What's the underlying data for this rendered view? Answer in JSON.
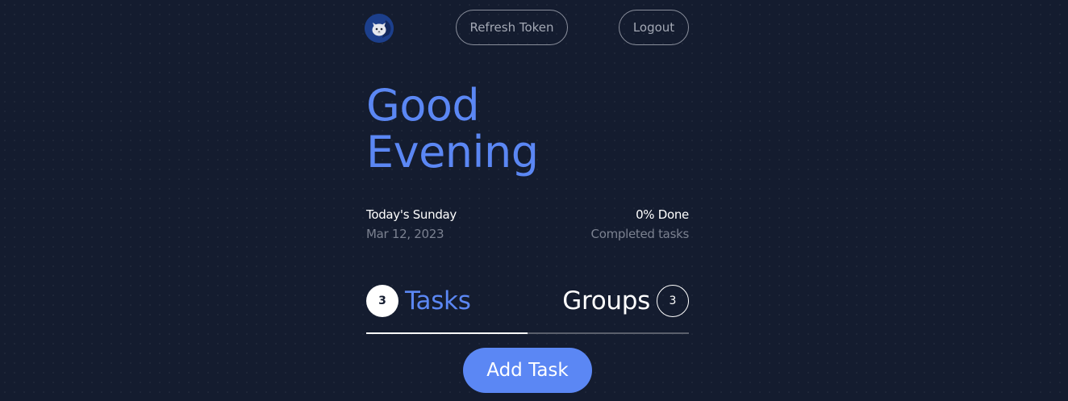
{
  "header": {
    "avatar_icon": "cat-avatar-icon",
    "refresh_label": "Refresh Token",
    "logout_label": "Logout"
  },
  "greeting": {
    "line1": "Good",
    "line2": "Evening"
  },
  "today": {
    "title": "Today's Sunday",
    "date": "Mar 12, 2023"
  },
  "progress": {
    "title": "0% Done",
    "subtitle": "Completed tasks"
  },
  "tabs": {
    "tasks": {
      "count": "3",
      "label": "Tasks"
    },
    "groups": {
      "count": "3",
      "label": "Groups"
    },
    "active": "tasks"
  },
  "actions": {
    "add_task_label": "Add Task"
  },
  "colors": {
    "background": "#141c2f",
    "accent": "#5b87f4",
    "text": "#ffffff",
    "muted": "#7b8190"
  }
}
